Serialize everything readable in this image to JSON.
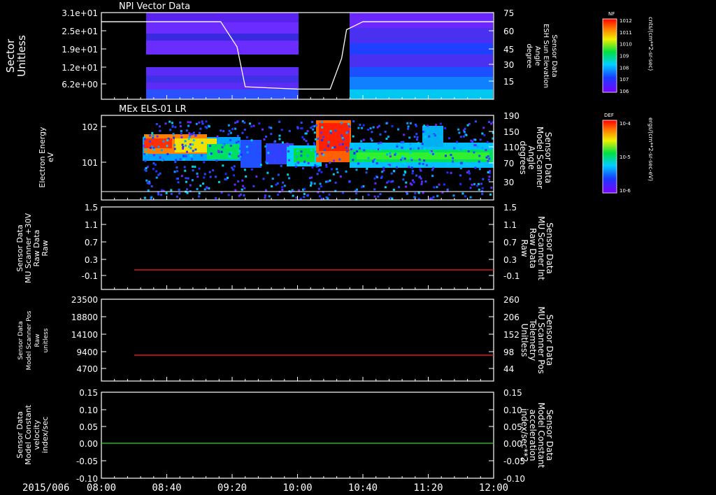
{
  "title_date": "2015/006",
  "time_ticks": [
    "08:00",
    "08:40",
    "09:20",
    "10:00",
    "10:40",
    "11:20",
    "12:00"
  ],
  "panels": [
    {
      "title": "NPI Vector Data",
      "left_label": [
        "Sector",
        "Unitless"
      ],
      "left_ticks": [
        "3.1e+01",
        "2.5e+01",
        "1.9e+01",
        "1.2e+01",
        "6.2e+00"
      ],
      "right_label": [
        "Sensor Data",
        "ESH Sun Elevation",
        "Angle",
        "degree"
      ],
      "right_ticks": [
        "75",
        "60",
        "45",
        "30",
        "15"
      ],
      "right_color": "#ffffff",
      "colorbar": {
        "tag": "NF",
        "unit": "cnts/(cm**2-sr-sec)",
        "ticks": [
          "10^12",
          "10^11",
          "10^10",
          "10^9",
          "10^8",
          "10^7",
          "10^6"
        ]
      }
    },
    {
      "title": "MEx ELS-01 LR",
      "left_label": [
        "Electron Energy",
        "eV"
      ],
      "left_ticks": [
        "10^2",
        "10^1"
      ],
      "right_label": [
        "Sensor Data",
        "Model Scanner",
        "Angle",
        "degrees"
      ],
      "right_ticks": [
        "190",
        "150",
        "110",
        "70",
        "30"
      ],
      "right_color": "#ffffff",
      "colorbar": {
        "tag": "DEF",
        "unit": "ergs/(cm**2-sr-sec-eV)",
        "ticks": [
          "10^-4",
          "10^-5",
          "10^-6"
        ]
      }
    },
    {
      "left_label": [
        "Sensor Data",
        "MU Scanner +30V",
        "Raw Data",
        "Raw"
      ],
      "left_ticks": [
        "1.5",
        "1.1",
        "0.7",
        "0.3",
        "-0.1"
      ],
      "right_label": [
        "Sensor Data",
        "MU Scanner Int",
        "Raw Data",
        "Raw"
      ],
      "right_ticks": [
        "1.5",
        "1.1",
        "0.7",
        "0.3",
        "-0.1"
      ],
      "right_color": "#ff2020"
    },
    {
      "left_label": [
        "Sensor Data",
        "Model Scanner Pos",
        "Raw",
        "unitless"
      ],
      "left_ticks": [
        "23500",
        "18800",
        "14100",
        "9400",
        "4700"
      ],
      "right_label": [
        "Sensor Data",
        "MU Scanner Pos",
        "Telemetry",
        "Unitless"
      ],
      "right_ticks": [
        "260",
        "206",
        "152",
        "98",
        "44"
      ],
      "right_color": "#ff2020"
    },
    {
      "left_label": [
        "Sensor Data",
        "Model Constant",
        "velocity",
        "index/sec"
      ],
      "left_ticks": [
        "0.15",
        "0.10",
        "0.05",
        "0.00",
        "-0.05",
        "-0.10"
      ],
      "right_label": [
        "Sensor Data",
        "Model Constant",
        "acceleration",
        "index/sec**2"
      ],
      "right_ticks": [
        "0.15",
        "0.10",
        "0.05",
        "0.00",
        "-0.05",
        "-0.10"
      ],
      "right_color": "#20e020"
    }
  ],
  "chart_data": [
    {
      "type": "heatmap",
      "title": "NPI Vector Data",
      "ylabel": "Sector Unitless",
      "series": [
        {
          "name": "ESH Sun Elevation Angle",
          "type": "line",
          "x": [
            "08:00",
            "08:40",
            "09:13",
            "09:23",
            "09:28",
            "10:00",
            "10:20",
            "10:27",
            "10:30",
            "10:40",
            "12:00"
          ],
          "y": [
            67,
            67,
            67,
            45,
            10,
            8,
            8,
            35,
            60,
            67,
            67
          ]
        }
      ]
    },
    {
      "type": "heatmap",
      "title": "MEx ELS-01 LR",
      "ylabel": "Electron Energy eV"
    },
    {
      "type": "line",
      "series": [
        {
          "name": "MU Scanner +30V Raw Data",
          "color": "#ff2020",
          "x": [
            "08:20",
            "12:00"
          ],
          "y": [
            0.05,
            0.05
          ]
        }
      ],
      "ylim": [
        -0.3,
        1.5
      ]
    },
    {
      "type": "line",
      "series": [
        {
          "name": "Model Scanner Pos Raw",
          "color": "#ff2020",
          "x": [
            "08:20",
            "12:00"
          ],
          "y": [
            8400,
            8400
          ]
        }
      ],
      "ylim": [
        0,
        23500
      ]
    },
    {
      "type": "line",
      "series": [
        {
          "name": "Model Constant velocity",
          "color": "#20e020",
          "x": [
            "08:00",
            "12:00"
          ],
          "y": [
            0,
            0
          ]
        }
      ],
      "ylim": [
        -0.1,
        0.15
      ]
    }
  ]
}
